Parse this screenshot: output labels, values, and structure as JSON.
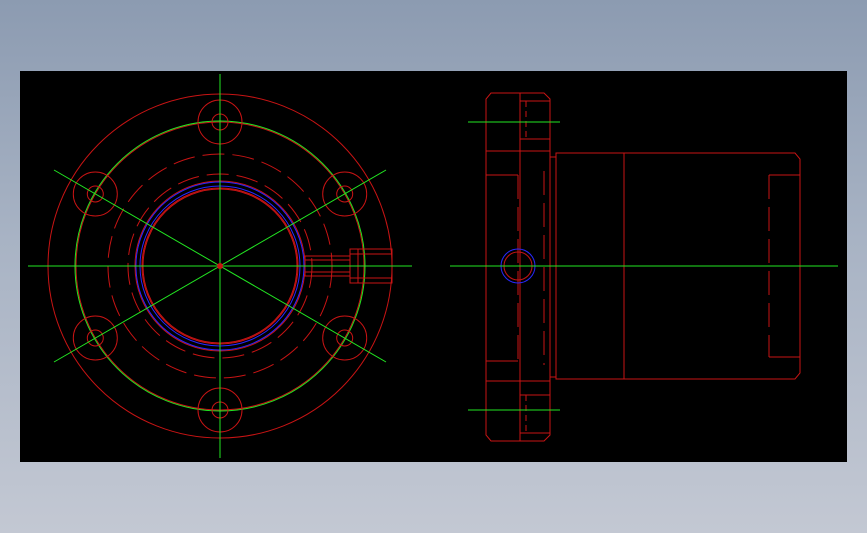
{
  "colors": {
    "background": "#000000",
    "outline": "#c81414",
    "centerline": "#22e622",
    "thread": "#2828ff",
    "frame_gradient_top": "#8c9bb1",
    "frame_gradient_bottom": "#c3c8d3"
  },
  "drawing": {
    "views": [
      "front-view",
      "side-view"
    ],
    "bolt_holes": 6
  }
}
